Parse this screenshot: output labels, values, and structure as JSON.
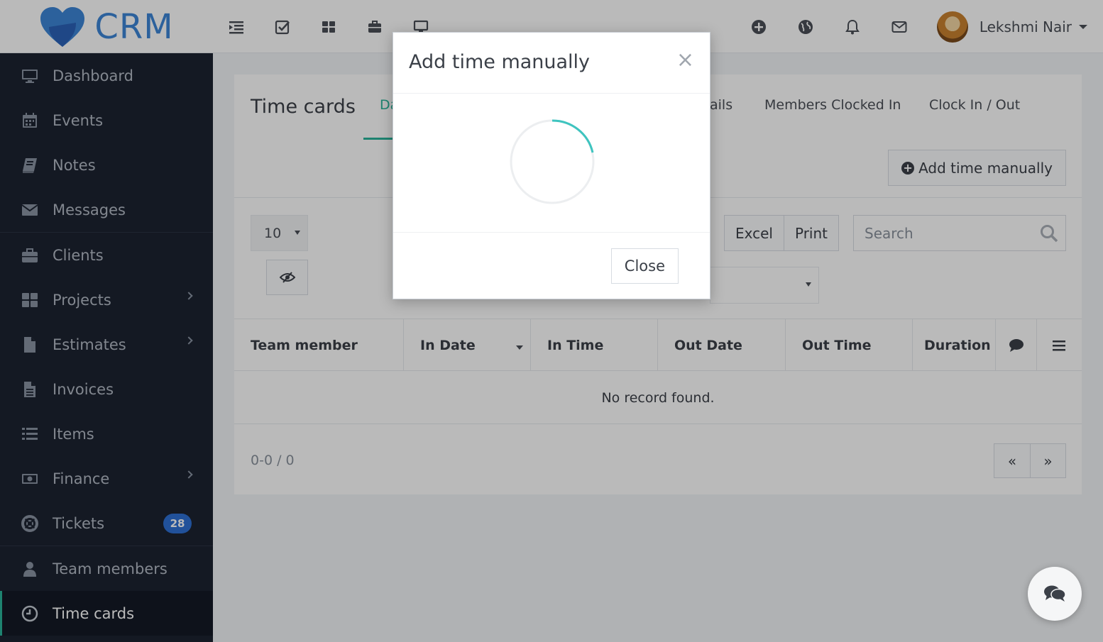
{
  "app": {
    "logo_text": "CRM"
  },
  "topbar": {
    "user_name": "Lekshmi Nair"
  },
  "sidebar": {
    "items": [
      {
        "label": "Dashboard",
        "icon": "monitor-icon"
      },
      {
        "label": "Events",
        "icon": "calendar-icon"
      },
      {
        "label": "Notes",
        "icon": "book-icon"
      },
      {
        "label": "Messages",
        "icon": "envelope-icon"
      },
      {
        "label": "Clients",
        "icon": "briefcase-icon"
      },
      {
        "label": "Projects",
        "icon": "grid-icon"
      },
      {
        "label": "Estimates",
        "icon": "file-icon"
      },
      {
        "label": "Invoices",
        "icon": "file-text-icon"
      },
      {
        "label": "Items",
        "icon": "list-icon"
      },
      {
        "label": "Finance",
        "icon": "money-icon"
      },
      {
        "label": "Tickets",
        "icon": "lifebuoy-icon",
        "badge": "28"
      },
      {
        "label": "Team members",
        "icon": "user-icon"
      },
      {
        "label": "Time cards",
        "icon": "clock-icon"
      }
    ]
  },
  "page": {
    "title": "Time cards",
    "tabs": [
      "Da",
      "ails",
      "Members Clocked In",
      "Clock In / Out"
    ],
    "add_button": "Add time manually",
    "page_size": "10",
    "export_buttons": [
      "Excel",
      "Print"
    ],
    "search_placeholder": "Search",
    "columns": [
      "Team member",
      "In Date",
      "In Time",
      "Out Date",
      "Out Time",
      "Duration"
    ],
    "empty_message": "No record found.",
    "pager_info": "0-0 / 0",
    "pager_prev": "«",
    "pager_next": "»"
  },
  "modal": {
    "title": "Add time manually",
    "close_x": "×",
    "close_button": "Close"
  },
  "colors": {
    "accent": "#2ab49a",
    "sidebar_bg": "#1c2331",
    "badge": "#2e6fd4",
    "logo": "#3d86d6"
  }
}
